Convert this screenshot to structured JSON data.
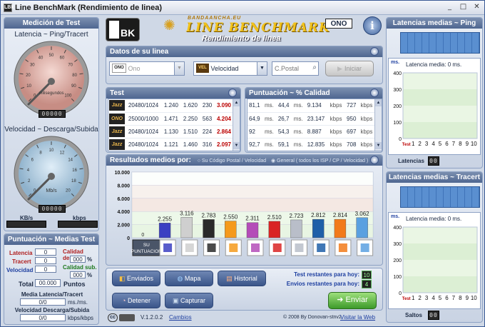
{
  "window": {
    "title": "Line BenchMark (Rendimiento de linea)",
    "app_icon": "LBk"
  },
  "left": {
    "title": "Medición de Test",
    "ping_gauge_title": "Latencia ~ Ping/Tracert",
    "ping_unit": "milisegundos",
    "ping_counter": "00000",
    "speed_gauge_title": "Velocidad ~ Descarga/Subida",
    "speed_unit": "Mb/s",
    "speed_counter": "00000",
    "kb_label": "KB/s",
    "kbps_label": "kbps",
    "ping_ticks": [
      "0",
      "10",
      "20",
      "30",
      "40",
      "50",
      "60",
      "70",
      "80",
      "90",
      "100"
    ],
    "speed_ticks": [
      "0",
      "2",
      "4",
      "6",
      "8",
      "10",
      "12",
      "14",
      "16",
      "18",
      "20"
    ]
  },
  "scores": {
    "title": "Puntuación ~ Medias Test",
    "latencia": "Latencia",
    "latencia_val": "0",
    "tracert": "Tracert",
    "tracert_val": "0",
    "velocidad": "Velocidad",
    "velocidad_val": "0",
    "calidad_desc": "Calidad desc.",
    "calidad_desc_val": "000",
    "calidad_sub": "Calidad sub.",
    "calidad_sub_val": "000",
    "pct": "%",
    "total_label": "Total",
    "total_val": "00.000",
    "puntos": "Puntos",
    "media_lat": "Media Latencia/Tracert",
    "media_lat_val": "0/0",
    "ms_unit": "ms./ms.",
    "vel_ds": "Velocidad Descarga/Subida",
    "vel_ds_val": "0/0",
    "kbps_unit": "kbps/kbps"
  },
  "header": {
    "brand_top": "BANDAANCHA.EU",
    "brand_main": "LINE BENCHMARK",
    "brand_sub": "Rendimiento de linea",
    "isp_logo": "ONO",
    "lbk": "BK"
  },
  "datos": {
    "title": "Datos de su linea",
    "isp_value": "Ono",
    "isp_tag": "ONO",
    "type_value": "Velocidad",
    "type_tag": "VEL",
    "postal_placeholder": "C.Postal",
    "start_label": "Iniciar"
  },
  "test": {
    "title": "Test",
    "rows": [
      {
        "speed": "20480/1024",
        "a": "1.240",
        "b": "1.620",
        "c": "230",
        "score": "3.090",
        "logo": "Jazz"
      },
      {
        "speed": "25000/1000",
        "a": "1.471",
        "b": "2.250",
        "c": "563",
        "score": "4.204",
        "logo": "ONO"
      },
      {
        "speed": "20480/1024",
        "a": "1.130",
        "b": "1.510",
        "c": "224",
        "score": "2.864",
        "logo": "Jazz"
      },
      {
        "speed": "20480/1024",
        "a": "1.121",
        "b": "1.460",
        "c": "316",
        "score": "2.097",
        "logo": "Jazz"
      }
    ]
  },
  "puntuacion": {
    "title": "Puntuación ~ % Calidad",
    "rows": [
      {
        "ms1": "81,1",
        "u1": "ms.",
        "ms2": "44,4",
        "u2": "ms.",
        "k1": "9.134",
        "u3": "kbps",
        "k2": "727",
        "u4": "kbps"
      },
      {
        "ms1": "64,9",
        "u1": "ms.",
        "ms2": "26,7",
        "u2": "ms.",
        "k1": "23.147",
        "u3": "kbps",
        "k2": "950",
        "u4": "kbps"
      },
      {
        "ms1": "92",
        "u1": "ms.",
        "ms2": "54,3",
        "u2": "ms.",
        "k1": "8.887",
        "u3": "kbps",
        "k2": "697",
        "u4": "kbps"
      },
      {
        "ms1": "92,7",
        "u1": "ms.",
        "ms2": "59,1",
        "u2": "ms.",
        "k1": "12.835",
        "u3": "kbps",
        "k2": "708",
        "u4": "kbps"
      }
    ]
  },
  "resultados": {
    "title": "Resultados medios por:",
    "opt1": "Su Código Postal / Velocidad",
    "opt2": "General ( todos los ISP / CP / Velocidad )",
    "su_label1": "SU",
    "su_label2": "PUNTUACION",
    "su_val": "0"
  },
  "chart_data": {
    "type": "bar",
    "categories": [
      "SU PUNTUACION",
      "Tele2",
      "ONO",
      "Jazztel",
      "Orange",
      "Yacom",
      "Telefonica",
      "R",
      "TeleCable",
      "Euskaltel",
      "Otros"
    ],
    "values": [
      0,
      2.255,
      3.116,
      2.783,
      2.55,
      2.311,
      2.51,
      2.723,
      2.812,
      2.814,
      3.062
    ],
    "labels": [
      "",
      "2.255",
      "3.116",
      "2.783",
      "2.550",
      "2.311",
      "2.510",
      "2.723",
      "2.812",
      "2.814",
      "3.062"
    ],
    "colors": [
      "#cfcfcf",
      "#3b3fc2",
      "#cfcfcf",
      "#2a2a2a",
      "#f59a1c",
      "#b44db8",
      "#d92424",
      "#b9bec9",
      "#1f5fa8",
      "#f27a1a",
      "#5aa0e0"
    ],
    "ylim": [
      0,
      10000
    ],
    "yticks": [
      "0",
      "2.000",
      "4.000",
      "6.000",
      "8.000",
      "10.000"
    ]
  },
  "actions": {
    "enviados": "Enviados",
    "mapa": "Mapa",
    "historial": "Historial",
    "detener": "Detener",
    "capturar": "Capturar",
    "enviar": "Enviar",
    "test_rest": "Test restantes para hoy:",
    "test_rest_val": "10",
    "env_rest": "Envios restantes para hoy:",
    "env_rest_val": "4"
  },
  "footer": {
    "version": "V.1.2.0.2",
    "cambios": "Cambios",
    "copyright": "© 2008 By Donovan-stnv2",
    "web": "Visitar la Web",
    "cc": "cc"
  },
  "ping": {
    "title": "Latencias medias ~ Ping",
    "media": "Latencia media: 0 ms.",
    "ms": "ms.",
    "yticks": [
      "0",
      "100",
      "200",
      "300",
      "400"
    ],
    "xlabels": [
      "Test",
      "1",
      "2",
      "3",
      "4",
      "5",
      "6",
      "7",
      "8",
      "9",
      "10"
    ],
    "bottom": "Latencias",
    "bottom_val": "00"
  },
  "tracert": {
    "title": "Latencias medias ~ Tracert",
    "media": "Latencia media: 0 ms.",
    "ms": "ms.",
    "yticks": [
      "0",
      "100",
      "200",
      "300",
      "400"
    ],
    "xlabels": [
      "Test",
      "1",
      "2",
      "3",
      "4",
      "5",
      "6",
      "7",
      "8",
      "9",
      "10"
    ],
    "bottom": "Saltos",
    "bottom_val": "00"
  }
}
